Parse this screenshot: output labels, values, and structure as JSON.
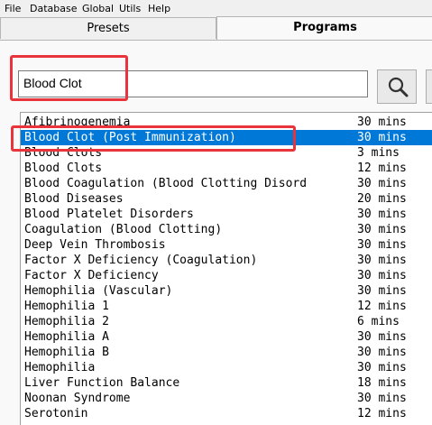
{
  "menu": [
    "File",
    "Database",
    "Global",
    "Utils",
    "Help"
  ],
  "tabs": {
    "presets": "Presets",
    "programs": "Programs"
  },
  "search": {
    "value": "Blood Clot"
  },
  "programs": [
    {
      "name": "Afibrinogenemia",
      "duration": "30 mins",
      "selected": false
    },
    {
      "name": "Blood Clot (Post Immunization)",
      "duration": "30 mins",
      "selected": true
    },
    {
      "name": "Blood Clots",
      "duration": "3 mins",
      "selected": false
    },
    {
      "name": "Blood Clots",
      "duration": "12 mins",
      "selected": false
    },
    {
      "name": "Blood Coagulation (Blood Clotting Disord",
      "duration": "30 mins",
      "selected": false
    },
    {
      "name": "Blood Diseases",
      "duration": "20 mins",
      "selected": false
    },
    {
      "name": "Blood Platelet Disorders",
      "duration": "30 mins",
      "selected": false
    },
    {
      "name": "Coagulation (Blood Clotting)",
      "duration": "30 mins",
      "selected": false
    },
    {
      "name": "Deep Vein Thrombosis",
      "duration": "30 mins",
      "selected": false
    },
    {
      "name": "Factor X Deficiency (Coagulation)",
      "duration": "30 mins",
      "selected": false
    },
    {
      "name": "Factor X Deficiency",
      "duration": "30 mins",
      "selected": false
    },
    {
      "name": "Hemophilia (Vascular)",
      "duration": "30 mins",
      "selected": false
    },
    {
      "name": "Hemophilia 1",
      "duration": "12 mins",
      "selected": false
    },
    {
      "name": "Hemophilia 2",
      "duration": "6 mins",
      "selected": false
    },
    {
      "name": "Hemophilia A",
      "duration": "30 mins",
      "selected": false
    },
    {
      "name": "Hemophilia B",
      "duration": "30 mins",
      "selected": false
    },
    {
      "name": "Hemophilia",
      "duration": "30 mins",
      "selected": false
    },
    {
      "name": "Liver Function Balance",
      "duration": "18 mins",
      "selected": false
    },
    {
      "name": "Noonan Syndrome",
      "duration": "30 mins",
      "selected": false
    },
    {
      "name": "Serotonin",
      "duration": "12 mins",
      "selected": false
    }
  ],
  "colors": {
    "selection": "#0078d7",
    "highlight": "#e8343a"
  },
  "icons": {
    "search": "magnifier-icon"
  }
}
